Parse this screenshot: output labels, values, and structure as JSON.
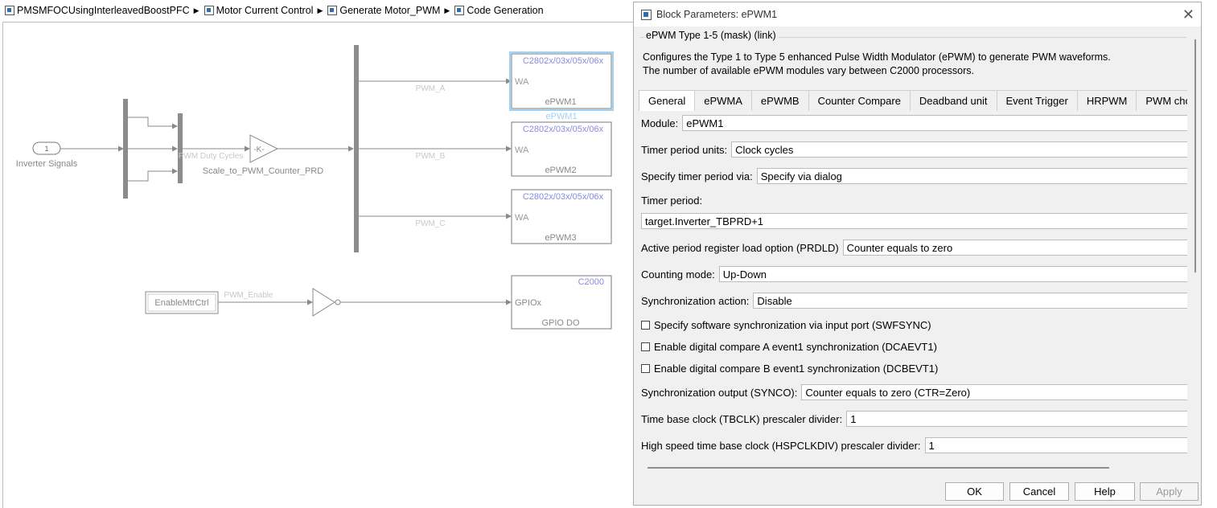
{
  "breadcrumb": {
    "items": [
      "PMSMFOCUsingInterleavedBoostPFC",
      "Motor Current Control",
      "Generate Motor_PWM",
      "Code Generation"
    ]
  },
  "model": {
    "inport_number": "1",
    "inport_label": "Inverter Signals",
    "signal_pwm_duty": "PWM Duty Cycles",
    "gain_symbol": "-K-",
    "gain_label": "Scale_to_PWM_Counter_PRD",
    "signal_a": "PWM_A",
    "signal_b": "PWM_B",
    "signal_c": "PWM_C",
    "signal_enable": "PWM_Enable",
    "enable_block": "EnableMtrCtrl",
    "epwm_blocks": [
      {
        "header": "C2802x/03x/05x/06x",
        "port": "WA",
        "name": "ePWM1",
        "caption": "ePWM1"
      },
      {
        "header": "C2802x/03x/05x/06x",
        "port": "WA",
        "name": "ePWM2"
      },
      {
        "header": "C2802x/03x/05x/06x",
        "port": "WA",
        "name": "ePWM3"
      }
    ],
    "gpio_block": {
      "header": "C2000",
      "port": "GPIOx",
      "name": "GPIO DO"
    }
  },
  "dialog": {
    "title": "Block Parameters: ePWM1",
    "mask_title": "ePWM Type 1-5 (mask) (link)",
    "description_1": "Configures the Type 1 to Type 5 enhanced Pulse Width Modulator (ePWM) to generate PWM waveforms.",
    "description_2": "The number of available ePWM modules vary between C2000 processors.",
    "tabs": [
      "General",
      "ePWMA",
      "ePWMB",
      "Counter Compare",
      "Deadband unit",
      "Event Trigger",
      "HRPWM",
      "PWM cho"
    ],
    "module_label": "Module:",
    "module_value": "ePWM1",
    "timer_units_label": "Timer period units:",
    "timer_units_value": "Clock cycles",
    "specify_period_label": "Specify timer period via:",
    "specify_period_value": "Specify via dialog",
    "timer_period_label": "Timer period:",
    "timer_period_value": "target.Inverter_TBPRD+1",
    "prdld_label": "Active period register load option (PRDLD)",
    "prdld_value": "Counter equals to zero",
    "counting_label": "Counting mode:",
    "counting_value": "Up-Down",
    "sync_action_label": "Synchronization action:",
    "sync_action_value": "Disable",
    "chk_swfsync": "Specify software synchronization via input port (SWFSYNC)",
    "chk_dcaevt1": "Enable digital compare A event1 synchronization (DCAEVT1)",
    "chk_dcbevt1": "Enable digital compare B event1 synchronization (DCBEVT1)",
    "synco_label": "Synchronization output (SYNCO):",
    "synco_value": "Counter equals to zero (CTR=Zero)",
    "tbclk_label": "Time base clock (TBCLK) prescaler divider:",
    "tbclk_value": "1",
    "hspclk_label": "High speed time base clock (HSPCLKDIV) prescaler divider:",
    "hspclk_value": "1",
    "buttons": {
      "ok": "OK",
      "cancel": "Cancel",
      "help": "Help",
      "apply": "Apply"
    }
  }
}
